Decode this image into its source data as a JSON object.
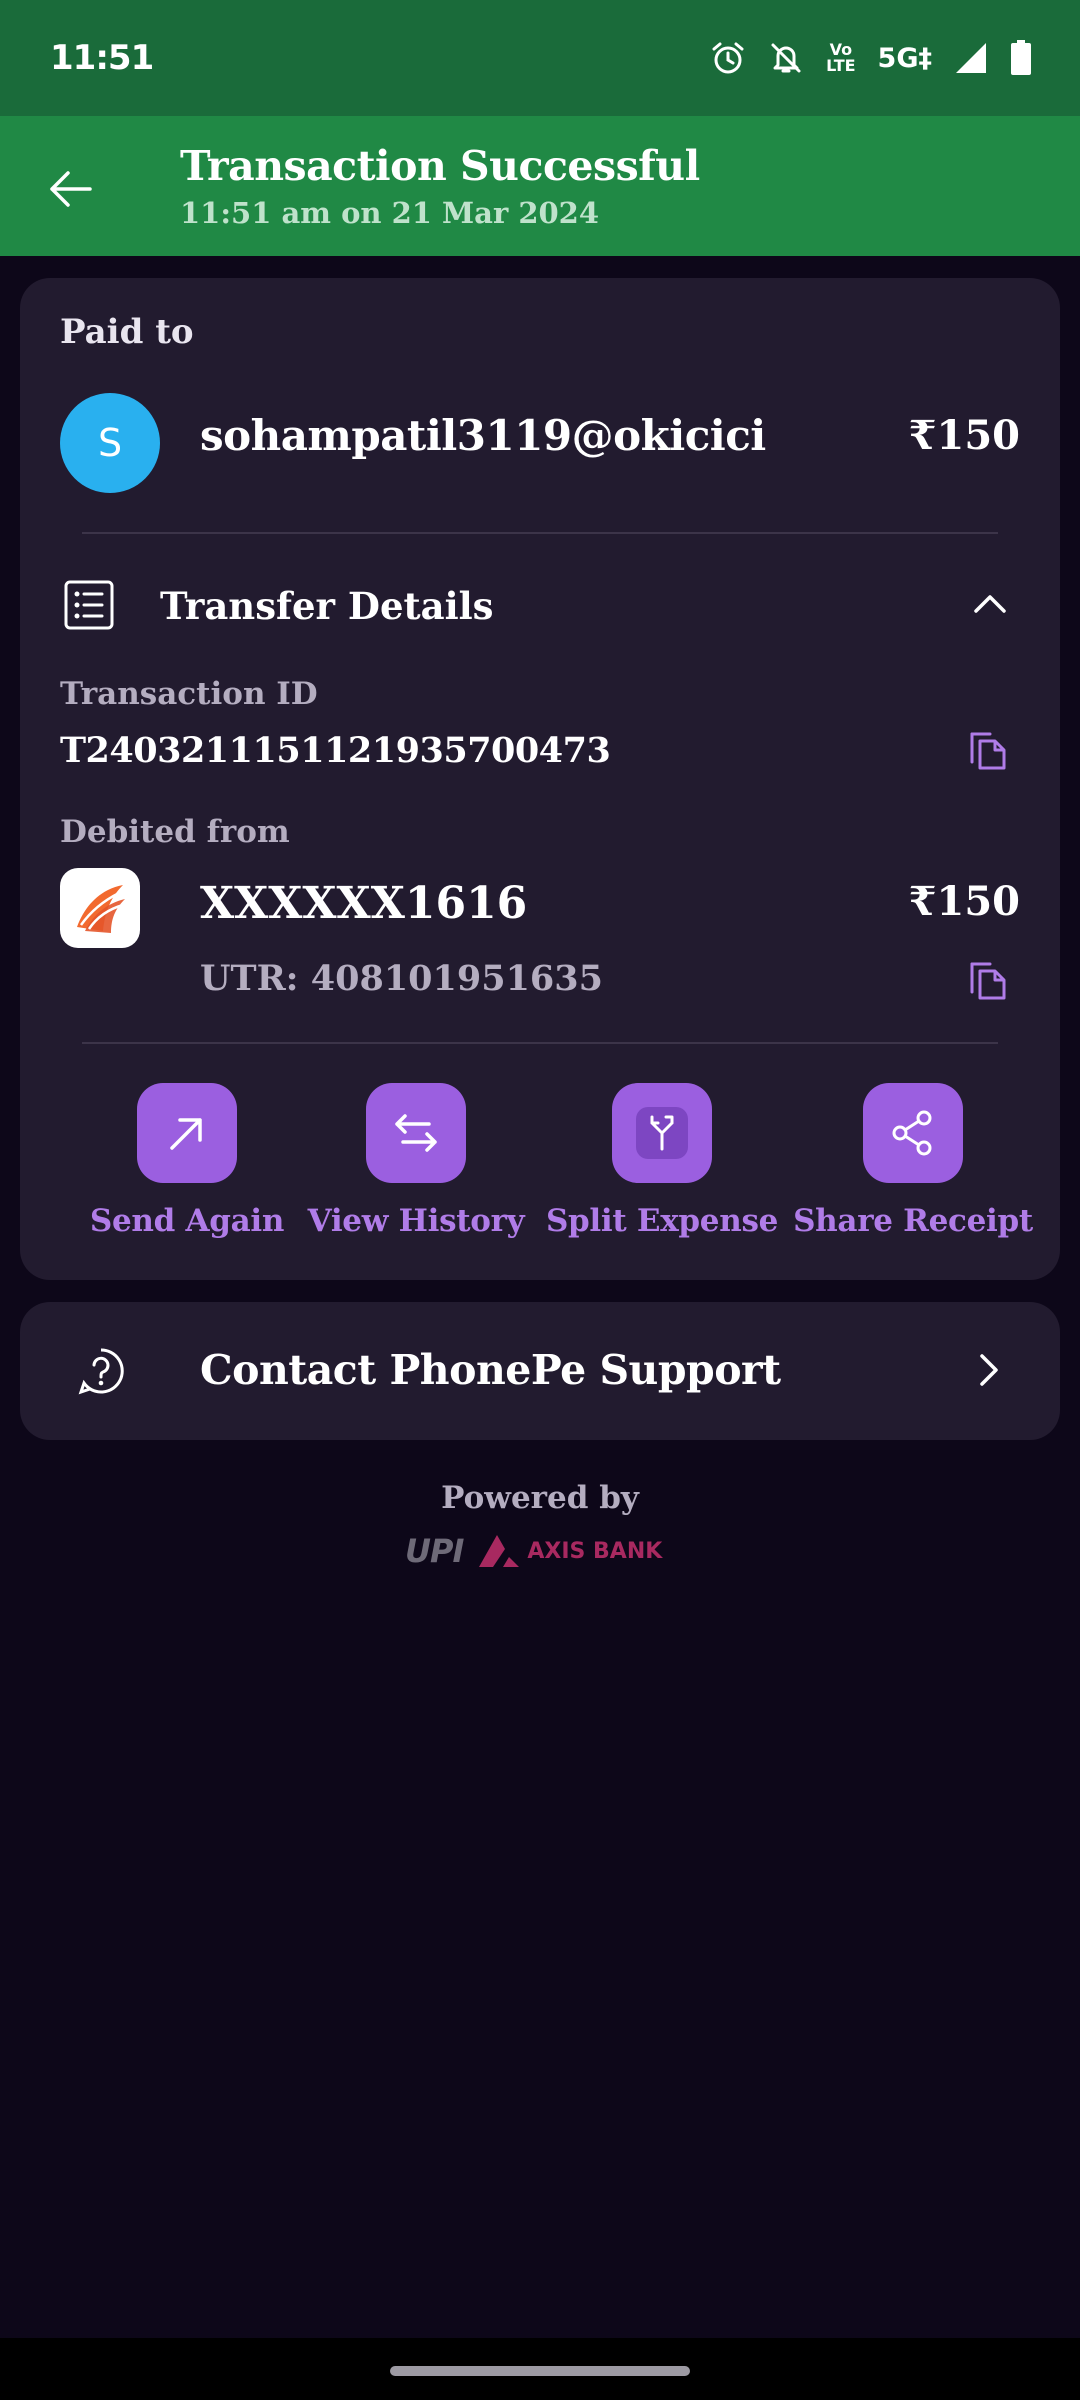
{
  "status_bar": {
    "time": "11:51",
    "net_top": "Vo",
    "net_bottom": "LTE",
    "net_5g": "5G‡"
  },
  "header": {
    "title": "Transaction Successful",
    "subtitle": "11:51 am on 21 Mar 2024",
    "bg_color": "#208945"
  },
  "payment": {
    "paid_to_label": "Paid to",
    "avatar_initial": "S",
    "payee": "sohampatil3119@okicici",
    "amount": "₹150"
  },
  "transfer_details": {
    "title": "Transfer Details",
    "transaction_id_label": "Transaction ID",
    "transaction_id": "T2403211151121935700473",
    "debited_from_label": "Debited from",
    "account": "XXXXXX1616",
    "debit_amount": "₹150",
    "utr": "UTR: 408101951635"
  },
  "actions": [
    {
      "label": "Send Again",
      "icon": "arrow-up-right-icon"
    },
    {
      "label": "View History",
      "icon": "swap-arrows-icon"
    },
    {
      "label": "Split Expense",
      "icon": "split-arrows-icon"
    },
    {
      "label": "Share Receipt",
      "icon": "share-icon"
    }
  ],
  "support": {
    "label": "Contact PhonePe Support"
  },
  "footer": {
    "powered_by": "Powered by",
    "upi_text": "UPI",
    "bank_text": "AXIS BANK"
  },
  "colors": {
    "accent": "#9b5fe0",
    "accent_text": "#b07ce8",
    "card_bg": "#221b2f",
    "page_bg": "#0d0719"
  }
}
